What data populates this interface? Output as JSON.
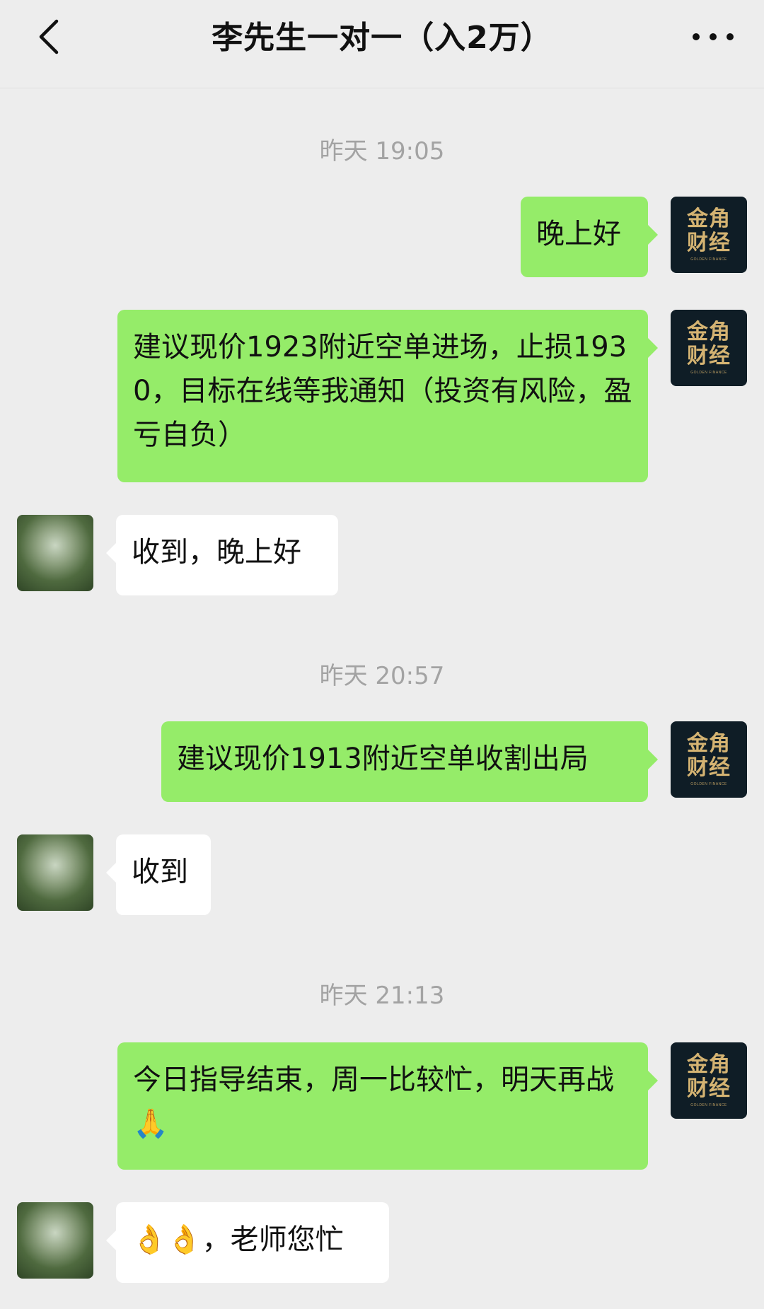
{
  "header": {
    "title": "李先生一对一（入2万）",
    "back_icon": "chevron-left-icon",
    "more_icon": "more-dots-icon"
  },
  "brand_avatar": {
    "line1": "金角",
    "line2": "财经",
    "sub": "GOLDEN FINANCE"
  },
  "messages": [
    {
      "type": "timestamp",
      "text": "昨天 19:05"
    },
    {
      "type": "out",
      "text": "晚上好"
    },
    {
      "type": "out",
      "text": "建议现价1923附近空单进场，止损1930，目标在线等我通知（投资有风险，盈亏自负）"
    },
    {
      "type": "in",
      "text": "收到，晚上好"
    },
    {
      "type": "timestamp",
      "text": "昨天 20:57"
    },
    {
      "type": "out",
      "text": "建议现价1913附近空单收割出局"
    },
    {
      "type": "in",
      "text": "收到"
    },
    {
      "type": "timestamp",
      "text": "昨天 21:13"
    },
    {
      "type": "out",
      "text": "今日指导结束，周一比较忙，明天再战🙏"
    },
    {
      "type": "in",
      "text": "👌👌，老师您忙"
    }
  ],
  "colors": {
    "background": "#ededed",
    "out_bubble": "#95ec69",
    "in_bubble": "#ffffff",
    "timestamp": "#a3a3a3",
    "brand_bg": "#0f1d26",
    "brand_gold": "#d4b372"
  }
}
